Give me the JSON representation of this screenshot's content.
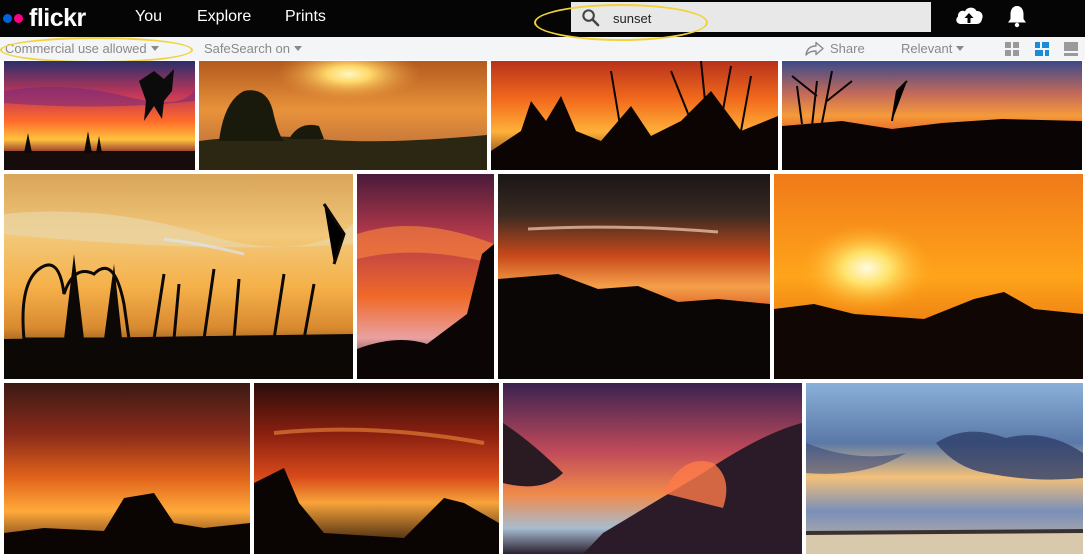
{
  "header": {
    "logo_text": "flickr",
    "nav": [
      "You",
      "Explore",
      "Prints"
    ],
    "search_value": "sunset"
  },
  "filters": {
    "license": "Commercial use allowed",
    "safesearch": "SafeSearch on",
    "share": "Share",
    "sort": "Relevant"
  },
  "icons": {
    "search": "search-icon",
    "upload": "cloud-upload-icon",
    "notifications": "bell-icon",
    "share": "share-arrow-icon",
    "views": [
      "grid-small-view-icon",
      "grid-justified-view-icon",
      "list-view-icon"
    ]
  },
  "colors": {
    "flickr_blue": "#0063dc",
    "flickr_pink": "#ff0084",
    "annotation": "#f1d23c"
  }
}
